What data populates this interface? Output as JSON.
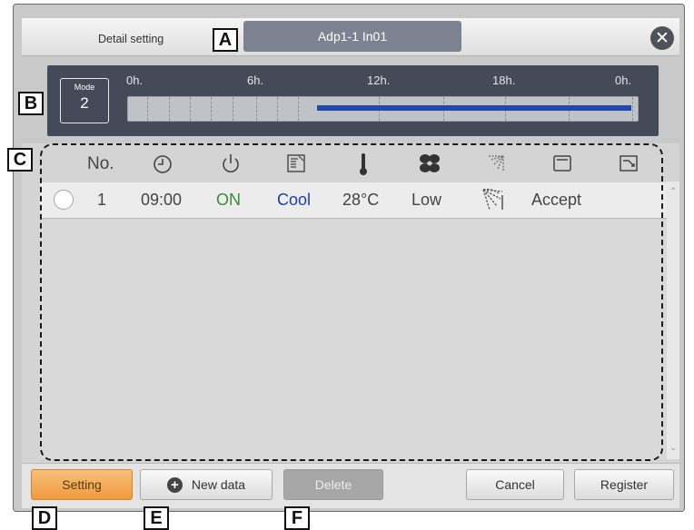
{
  "header": {
    "title": "Detail setting",
    "unit": "Adp1-1 In01",
    "close_symbol": "✕"
  },
  "timeline": {
    "mode_label": "Mode",
    "mode_value": "2",
    "ticks": [
      "0h.",
      "6h.",
      "12h.",
      "18h.",
      "0h."
    ],
    "active_start_hour": 9,
    "active_end_hour": 24,
    "active_color": "#2448a8"
  },
  "table": {
    "header_no": "No.",
    "column_icons": [
      "clock-icon",
      "power-icon",
      "mode-icon",
      "thermometer-icon",
      "fan-icon",
      "airflow-direction-icon",
      "window-icon",
      "setting-panel-icon"
    ],
    "rows": [
      {
        "no": "1",
        "time": "09:00",
        "power": "ON",
        "mode": "Cool",
        "temp": "28°C",
        "fan": "Low",
        "window": "Accept"
      }
    ],
    "colors": {
      "on": "#3a8a3a",
      "cool": "#1c3ea8"
    }
  },
  "buttons": {
    "setting": "Setting",
    "new_data": "New data",
    "delete": "Delete",
    "cancel": "Cancel",
    "register": "Register"
  },
  "callouts": [
    "A",
    "B",
    "C",
    "D",
    "E",
    "F"
  ]
}
